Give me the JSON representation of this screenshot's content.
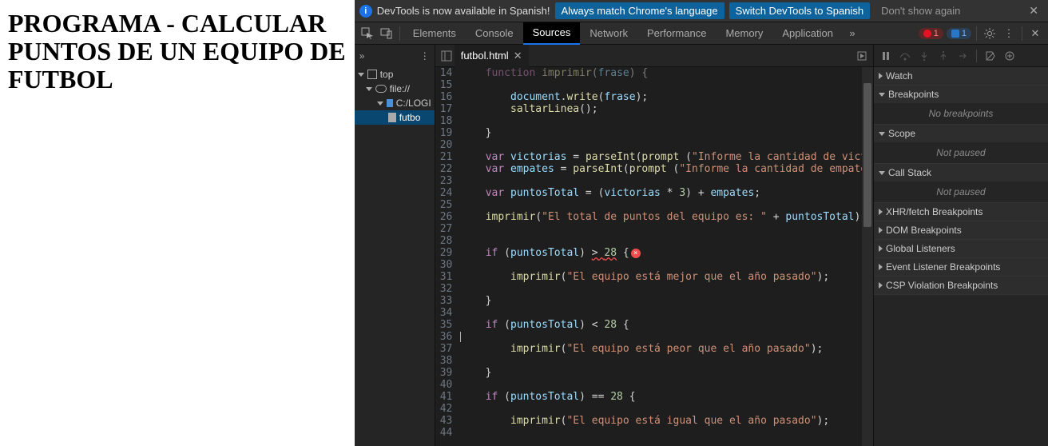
{
  "page": {
    "heading": "PROGRAMA - CALCULAR PUNTOS DE UN EQUIPO DE FUTBOL"
  },
  "notice": {
    "message": "DevTools is now available in Spanish!",
    "btn_match": "Always match Chrome's language",
    "btn_switch": "Switch DevTools to Spanish",
    "btn_dismiss": "Don't show again"
  },
  "tabs": {
    "elements": "Elements",
    "console": "Console",
    "sources": "Sources",
    "network": "Network",
    "performance": "Performance",
    "memory": "Memory",
    "application": "Application",
    "errors_count": "1",
    "info_count": "1"
  },
  "filetree": {
    "top": "top",
    "file_scheme": "file://",
    "drive": "C:/LOGI",
    "file": "futbo"
  },
  "editor": {
    "filename": "futbol.html",
    "first_line_no": 14,
    "lines": [
      {
        "html": "    <span class='kwd'>function</span> <span class='fn'>imprimir</span>(<span class='obj'>frase</span>) {",
        "dim": true
      },
      {
        "html": ""
      },
      {
        "html": "        <span class='obj'>document</span>.<span class='fn'>write</span>(<span class='obj'>frase</span>);"
      },
      {
        "html": "        <span class='fn'>saltarLinea</span>();"
      },
      {
        "html": ""
      },
      {
        "html": "    }"
      },
      {
        "html": ""
      },
      {
        "html": "    <span class='kwd'>var</span> <span class='obj'>victorias</span> = <span class='fn'>parseInt</span>(<span class='fn'>prompt</span> (<span class='str'>\"Informe la cantidad de victo</span>"
      },
      {
        "html": "    <span class='kwd'>var</span> <span class='obj'>empates</span> = <span class='fn'>parseInt</span>(<span class='fn'>prompt</span> (<span class='str'>\"Informe la cantidad de empates</span>"
      },
      {
        "html": ""
      },
      {
        "html": "    <span class='kwd'>var</span> <span class='obj'>puntosTotal</span> = (<span class='obj'>victorias</span> * <span class='num'>3</span>) + <span class='obj'>empates</span>;"
      },
      {
        "html": ""
      },
      {
        "html": "    <span class='fn'>imprimir</span>(<span class='str'>\"El total de puntos del equipo es: \"</span> + <span class='obj'>puntosTotal</span>);"
      },
      {
        "html": ""
      },
      {
        "html": ""
      },
      {
        "html": "    <span class='kwd'>if</span> (<span class='obj'>puntosTotal</span>) <span class='squiggle'>&gt; <span class='num'>28</span></span> {<span class='errmark'>×</span>"
      },
      {
        "html": ""
      },
      {
        "html": "        <span class='fn'>imprimir</span>(<span class='str'>\"El equipo está mejor que el año pasado\"</span>);"
      },
      {
        "html": ""
      },
      {
        "html": "    }"
      },
      {
        "html": ""
      },
      {
        "html": "    <span class='kwd'>if</span> (<span class='obj'>puntosTotal</span>) &lt; <span class='num'>28</span> {"
      },
      {
        "html": "<span class='cursor-caret'></span>"
      },
      {
        "html": "        <span class='fn'>imprimir</span>(<span class='str'>\"El equipo está peor que el año pasado\"</span>);"
      },
      {
        "html": ""
      },
      {
        "html": "    }"
      },
      {
        "html": ""
      },
      {
        "html": "    <span class='kwd'>if</span> (<span class='obj'>puntosTotal</span>) == <span class='num'>28</span> {"
      },
      {
        "html": ""
      },
      {
        "html": "        <span class='fn'>imprimir</span>(<span class='str'>\"El equipo está igual que el año pasado\"</span>);"
      },
      {
        "html": ""
      }
    ]
  },
  "debug": {
    "watch": "Watch",
    "breakpoints": "Breakpoints",
    "no_breakpoints": "No breakpoints",
    "scope": "Scope",
    "not_paused": "Not paused",
    "callstack": "Call Stack",
    "xhr": "XHR/fetch Breakpoints",
    "dom": "DOM Breakpoints",
    "global": "Global Listeners",
    "event": "Event Listener Breakpoints",
    "csp": "CSP Violation Breakpoints"
  }
}
